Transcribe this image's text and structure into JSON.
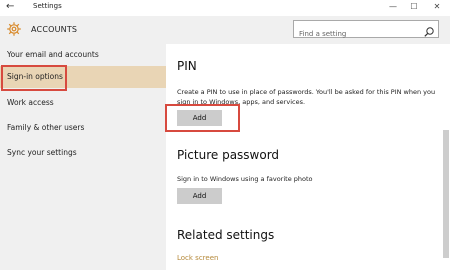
{
  "window": {
    "title": "Settings",
    "back_glyph": "←",
    "minimize_glyph": "—",
    "maximize_glyph": "☐",
    "close_glyph": "✕"
  },
  "header": {
    "section_title": "ACCOUNTS",
    "icon": "gear-icon",
    "accent_color": "#d88a2b"
  },
  "search": {
    "placeholder": "Find a setting",
    "icon": "search-icon"
  },
  "sidebar": {
    "items": [
      {
        "label": "Your email and accounts",
        "selected": false
      },
      {
        "label": "Sign-in options",
        "selected": true
      },
      {
        "label": "Work access",
        "selected": false
      },
      {
        "label": "Family & other users",
        "selected": false
      },
      {
        "label": "Sync your settings",
        "selected": false
      }
    ],
    "selected_color": "#e9d5b5"
  },
  "main": {
    "pin": {
      "heading": "PIN",
      "description": "Create a PIN to use in place of passwords. You'll be asked for this PIN when you sign in to Windows, apps, and services.",
      "button_label": "Add"
    },
    "picture_password": {
      "heading": "Picture password",
      "description": "Sign in to Windows using a favorite photo",
      "button_label": "Add"
    },
    "related": {
      "heading": "Related settings",
      "link_label": "Lock screen"
    }
  },
  "annotation_color": "#d74a3f",
  "link_color": "#b5893a"
}
